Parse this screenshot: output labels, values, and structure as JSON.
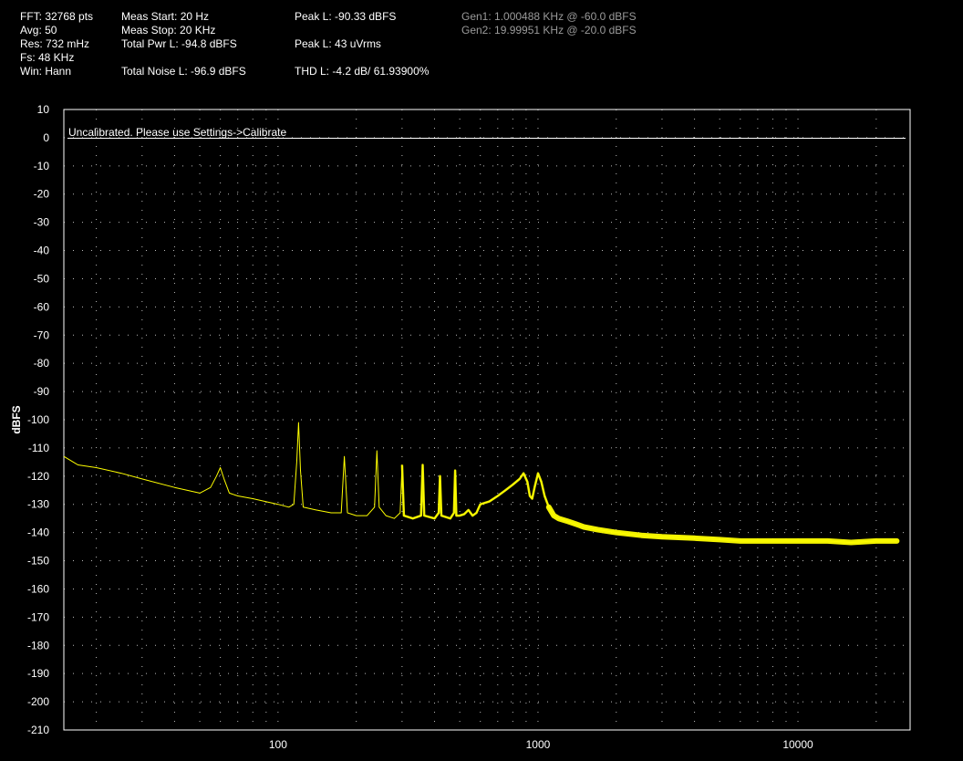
{
  "header": {
    "col1": [
      "FFT: 32768 pts",
      "Avg: 50",
      "Res: 732 mHz",
      "Fs: 48 KHz",
      "Win: Hann"
    ],
    "col2": [
      "Meas Start: 20 Hz",
      "Meas Stop: 20 KHz",
      "Total Pwr L: -94.8 dBFS",
      "",
      "Total Noise L: -96.9 dBFS"
    ],
    "col3": [
      "Peak L: -90.33 dBFS",
      "",
      "Peak L: 43 uVrms",
      "",
      "THD L: -4.2 dB/ 61.93900%"
    ],
    "gen": [
      "Gen1: 1.000488 KHz @ -60.0 dBFS",
      "Gen2: 19.99951 KHz @ -20.0 dBFS"
    ]
  },
  "chart_data": {
    "type": "line",
    "title": "",
    "ylabel": "dBFS",
    "xlabel": "",
    "xscale": "log",
    "xlim": [
      15,
      27000
    ],
    "ylim": [
      -210,
      10
    ],
    "yticks": [
      10,
      0,
      -10,
      -20,
      -30,
      -40,
      -50,
      -60,
      -70,
      -80,
      -90,
      -100,
      -110,
      -120,
      -130,
      -140,
      -150,
      -160,
      -170,
      -180,
      -190,
      -200,
      -210
    ],
    "xticks": [
      100,
      1000,
      10000
    ],
    "xtick_labels": [
      "100",
      "1000",
      "10000"
    ],
    "grid": true,
    "banner": "Uncalibrated. Please use Settings->Calibrate",
    "colors": {
      "trace": "#ffff00",
      "background": "#000000",
      "grid": "#bbbbbb",
      "frame": "#ffffff"
    },
    "series": [
      {
        "x": [
          15,
          17,
          20,
          25,
          30,
          40,
          50,
          55,
          58,
          60,
          62,
          65,
          70,
          80,
          100,
          110,
          115,
          118,
          120,
          122,
          125,
          140,
          160,
          175,
          180,
          185,
          200,
          220,
          235,
          240,
          245,
          260,
          280,
          295,
          300,
          305,
          330,
          355,
          360,
          365,
          400,
          415,
          420,
          425,
          460,
          475,
          480,
          485,
          500,
          520,
          540,
          560,
          580,
          600,
          650,
          700,
          750,
          800,
          850,
          880,
          910,
          930,
          950,
          970,
          1000,
          1030,
          1060,
          1100,
          1150,
          1200,
          1300,
          1400,
          1500,
          1700,
          2000,
          2500,
          3000,
          4000,
          5000,
          6000,
          8000,
          10000,
          13000,
          16000,
          20000,
          24000
        ],
        "y": [
          -113,
          -116,
          -117,
          -119,
          -121,
          -124,
          -126,
          -124,
          -120,
          -117,
          -121,
          -126,
          -127,
          -128,
          -130,
          -131,
          -130,
          -115,
          -101,
          -118,
          -131,
          -132,
          -133,
          -133,
          -113,
          -133,
          -134,
          -134,
          -131,
          -111,
          -131,
          -134,
          -135,
          -133,
          -116,
          -134,
          -135,
          -134,
          -116,
          -134,
          -135,
          -133,
          -120,
          -134,
          -135,
          -133,
          -118,
          -134,
          -134,
          -133.5,
          -132,
          -134,
          -133,
          -130,
          -129,
          -127,
          -125,
          -123,
          -121,
          -119,
          -122,
          -127,
          -128,
          -124,
          -119,
          -122,
          -127,
          -131,
          -134,
          -135,
          -136,
          -137,
          -138,
          -139,
          -140,
          -141,
          -141.5,
          -142,
          -142.5,
          -143,
          -143,
          -143,
          -143,
          -143.5,
          -143,
          -143
        ]
      }
    ]
  }
}
